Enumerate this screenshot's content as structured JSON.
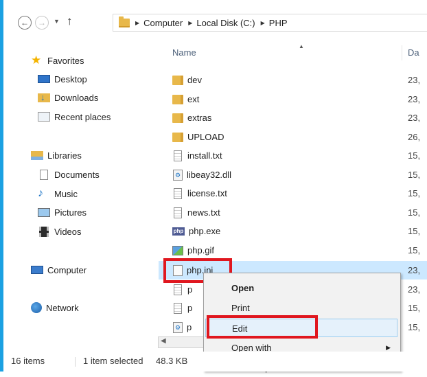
{
  "nav": {
    "back_glyph": "←",
    "forward_glyph": "→",
    "up_glyph": "↑",
    "breadcrumb": [
      "Computer",
      "Local Disk (C:)",
      "PHP"
    ]
  },
  "sidebar": {
    "favorites": {
      "label": "Favorites",
      "items": [
        "Desktop",
        "Downloads",
        "Recent places"
      ]
    },
    "libraries": {
      "label": "Libraries",
      "items": [
        "Documents",
        "Music",
        "Pictures",
        "Videos"
      ]
    },
    "computer": "Computer",
    "network": "Network"
  },
  "filelist": {
    "columns": {
      "name": "Name",
      "date": "Da"
    },
    "rows": [
      {
        "name": "dev",
        "date": "23,",
        "icon": "folder-icon"
      },
      {
        "name": "ext",
        "date": "23,",
        "icon": "folder-icon"
      },
      {
        "name": "extras",
        "date": "23,",
        "icon": "folder-icon"
      },
      {
        "name": "UPLOAD",
        "date": "26,",
        "icon": "folder-icon"
      },
      {
        "name": "install.txt",
        "date": "15,",
        "icon": "text-file-icon"
      },
      {
        "name": "libeay32.dll",
        "date": "15,",
        "icon": "dll-file-icon"
      },
      {
        "name": "license.txt",
        "date": "15,",
        "icon": "text-file-icon"
      },
      {
        "name": "news.txt",
        "date": "15,",
        "icon": "text-file-icon"
      },
      {
        "name": "php.exe",
        "date": "15,",
        "icon": "php-exe-icon"
      },
      {
        "name": "php.gif",
        "date": "15,",
        "icon": "image-file-icon"
      },
      {
        "name": "php.ini",
        "date": "23,",
        "icon": "ini-file-icon",
        "selected": true
      },
      {
        "name": "p",
        "date": "23,",
        "icon": "text-file-icon"
      },
      {
        "name": "p",
        "date": "15,",
        "icon": "text-file-icon"
      },
      {
        "name": "p",
        "date": "15,",
        "icon": "dll-file-icon"
      }
    ]
  },
  "context_menu": {
    "items": [
      "Open",
      "Print",
      "Edit",
      "Open with",
      "Restore previous versions"
    ],
    "submenu_arrow": "▶"
  },
  "statusbar": {
    "item_count": "16 items",
    "selection": "1 item selected",
    "size": "48.3 KB"
  },
  "colors": {
    "accent": "#1ba1e2",
    "selection": "#cce8ff",
    "highlight_box": "#e0171f"
  }
}
